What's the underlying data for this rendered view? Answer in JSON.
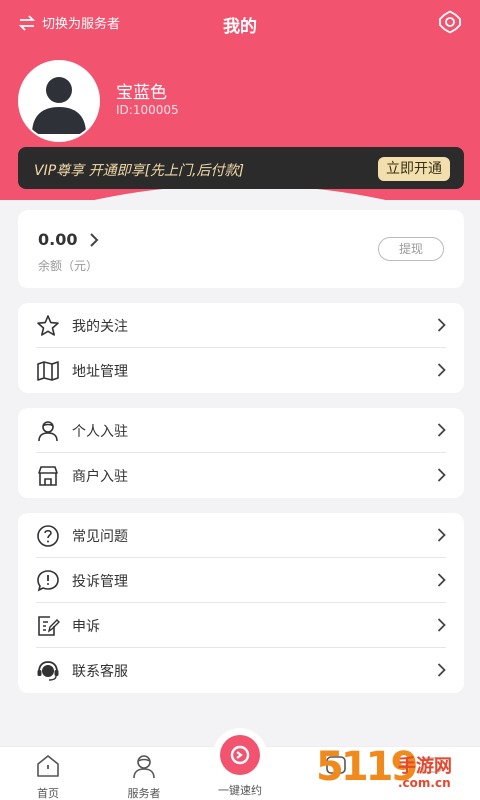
{
  "header": {
    "switch_label": "切换为服务者",
    "title": "我的",
    "user_name": "宝蓝色",
    "user_id": "ID:100005"
  },
  "vip": {
    "text": "VIP尊享 开通即享[先上门,后付款]",
    "button": "立即开通"
  },
  "balance": {
    "amount": "0.00",
    "label": "余额（元）",
    "withdraw": "提现"
  },
  "group1": [
    {
      "label": "我的关注",
      "icon": "star-icon"
    },
    {
      "label": "地址管理",
      "icon": "map-icon"
    }
  ],
  "group2": [
    {
      "label": "个人入驻",
      "icon": "person-icon"
    },
    {
      "label": "商户入驻",
      "icon": "shop-icon"
    }
  ],
  "group3": [
    {
      "label": "常见问题",
      "icon": "question-icon"
    },
    {
      "label": "投诉管理",
      "icon": "alert-icon"
    },
    {
      "label": "申诉",
      "icon": "edit-icon"
    },
    {
      "label": "联系客服",
      "icon": "headset-icon"
    }
  ],
  "tabbar": {
    "home": "首页",
    "provider": "服务者",
    "quick": "一键速约"
  },
  "watermark": {
    "number": "5119",
    "name": "手游网",
    "domain": ".com.cn"
  },
  "colors": {
    "brand": "#f2546f",
    "vip_bg": "#2b2b2b",
    "vip_gold": "#f3dfae"
  }
}
